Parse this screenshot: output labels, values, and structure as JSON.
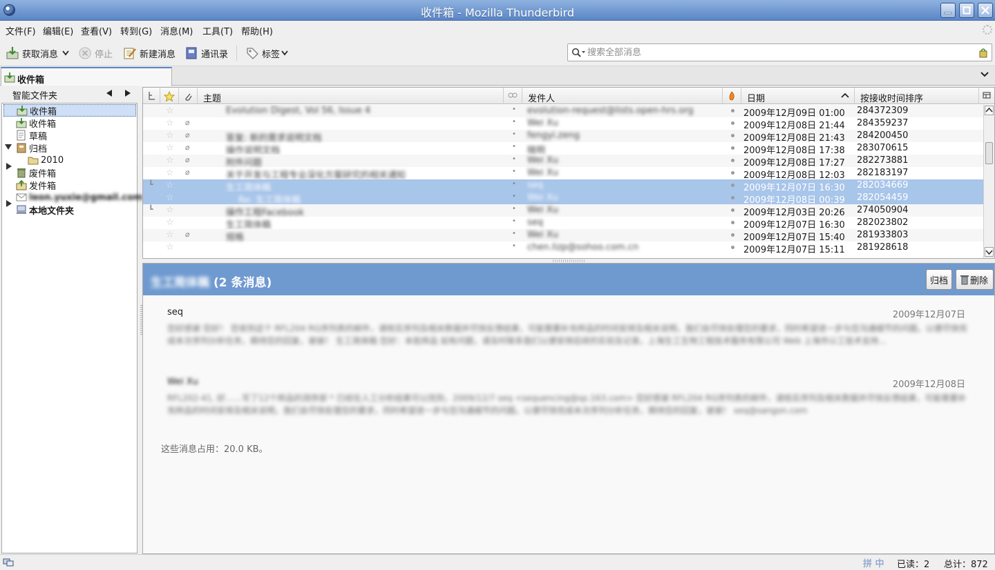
{
  "window": {
    "title": "收件箱 - Mozilla Thunderbird"
  },
  "menu": [
    "文件(F)",
    "编辑(E)",
    "查看(V)",
    "转到(G)",
    "消息(M)",
    "工具(T)",
    "帮助(H)"
  ],
  "toolbar": {
    "get_mail": "获取消息",
    "stop": "停止",
    "write": "新建消息",
    "address_book": "通讯录",
    "tag": "标签"
  },
  "search": {
    "placeholder": "搜索全部消息"
  },
  "tab": {
    "label": "收件箱"
  },
  "folder_pane": {
    "header": "智能文件夹",
    "folders": [
      {
        "label": "收件箱",
        "icon": "inbox-icon",
        "selected": true
      },
      {
        "label": "收件箱",
        "icon": "inbox-icon"
      },
      {
        "label": "草稿",
        "icon": "drafts-icon"
      },
      {
        "label": "归档",
        "icon": "archive-icon",
        "expanded": true
      },
      {
        "label": "2010",
        "icon": "folder-icon"
      },
      {
        "label": "废件箱",
        "icon": "trash-icon",
        "collapsed": true
      },
      {
        "label": "发件箱",
        "icon": "sent-icon"
      },
      {
        "label": "leon.yuxie@gmail.com",
        "icon": "mail-account-icon"
      },
      {
        "label": "本地文件夹",
        "icon": "local-folders-icon",
        "collapsed": true
      }
    ]
  },
  "thread_pane": {
    "columns": {
      "subject": "主题",
      "from": "发件人",
      "date": "日期",
      "received": "按接收时间排序"
    },
    "rows": [
      {
        "subject": "Evolution Digest, Vol 56, Issue 4",
        "from": "evolution-request@lists.open-hrs.org",
        "date": "2009年12月09日 01:00",
        "order": "284372309",
        "attach": false
      },
      {
        "subject": "",
        "from": "Wei Xu",
        "date": "2009年12月08日 21:44",
        "order": "284359237",
        "attach": true
      },
      {
        "subject": "答复: 新的需求说明文档",
        "from": "fengyi.zeng",
        "date": "2009年12月08日 21:43",
        "order": "284200450",
        "attach": true
      },
      {
        "subject": "操作说明文档",
        "from": "晓明",
        "date": "2009年12月08日 17:38",
        "order": "283070615",
        "attach": true
      },
      {
        "subject": "附件问题",
        "from": "Wei Xu",
        "date": "2009年12月08日 17:27",
        "order": "282273881",
        "attach": true
      },
      {
        "subject": "关于开发与工程专业深化方案研究的相关通知",
        "from": "Wei Xu",
        "date": "2009年12月08日 12:03",
        "order": "282183197",
        "attach": true
      },
      {
        "subject": "生工简体稿",
        "from": "seq",
        "date": "2009年12月07日 16:30",
        "order": "282034669",
        "selected": true,
        "thread": true
      },
      {
        "subject": "Re: 生工简体稿",
        "from": "Wei Xu",
        "date": "2009年12月08日 00:39",
        "order": "282054459",
        "selected": true
      },
      {
        "subject": "操作工程Facebook",
        "from": "Wei Xu",
        "date": "2009年12月03日 20:26",
        "order": "274050904",
        "thread": true
      },
      {
        "subject": "生工简体稿",
        "from": "seq",
        "date": "2009年12月07日 16:30",
        "order": "282023802"
      },
      {
        "subject": "规格",
        "from": "Wei Xu",
        "date": "2009年12月07日 15:40",
        "order": "281933803",
        "attach": true
      },
      {
        "subject": "",
        "from": "chen.lizp@sohoo.com.cn",
        "date": "2009年12月07日 15:11",
        "order": "281928618"
      }
    ]
  },
  "message_pane": {
    "thread_subject": "生工简体稿",
    "count_label": "(2 条消息)",
    "archive_label": "归档",
    "delete_label": "删除",
    "messages": [
      {
        "author": "seq",
        "date": "2009年12月07日",
        "snippet": "您好感谢 您好！ 您收到这个 RFL204 RG序列表的邮件，请核实序列及相关数据并尽快反馈结果，可能需要补充样品的时间安排及相关说明，我们会尽快处理您的要求，同时希望进一步与您沟通细节的问题。以便尽快完成本次序列分析任务，期待您的回复，谢谢！ 生工简体稿 您好：本批样品 如有问题，请及时联系我们以便安排后续的实验及记录。上海生工生物工程技术服务有限公司 Web 上海市以工技术支持..."
      },
      {
        "author": "Wei Xu",
        "date": "2009年12月08日",
        "snippet": "RFL202-41, 好……写了12个样品的测序部 * 已经在人工分析结果可以找到，2009/12/7 seq <sequencing@sp.163.com> 您好感谢 RFL204 RG序列表的邮件，请核实序列及相关数据并尽快反馈结果，可能需要补充样品的时间安排及相关说明，我们会尽快处理您的要求，同时希望进一步与您沟通细节的问题。以便尽快完成本次序列分析任务，期待您的回复，谢谢！ seq@sangon.com"
      }
    ],
    "size_note": "这些消息占用：20.0 KB。"
  },
  "status": {
    "ime": "拼 中",
    "unread": "已读：2",
    "total": "总计：872"
  }
}
